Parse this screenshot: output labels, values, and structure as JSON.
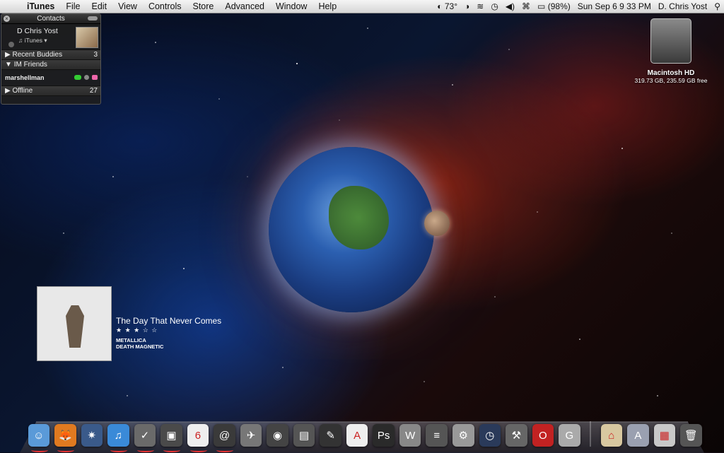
{
  "menubar": {
    "app_name": "iTunes",
    "menus": [
      "File",
      "Edit",
      "View",
      "Controls",
      "Store",
      "Advanced",
      "Window",
      "Help"
    ],
    "weather": "73°",
    "battery": "(98%)",
    "clock": "Sun Sep 6  9 33 PM",
    "user": "D. Chris Yost"
  },
  "contacts": {
    "title": "Contacts",
    "me_name": "D Chris Yost",
    "me_status": "iTunes",
    "groups": [
      {
        "label": "Recent Buddies",
        "count": "3"
      },
      {
        "label": "IM Friends",
        "count": ""
      },
      {
        "label": "Offline",
        "count": "27"
      }
    ],
    "buddy": "marshellman"
  },
  "drive": {
    "label": "Macintosh HD",
    "info": "319.73 GB, 235.59 GB free"
  },
  "nowplaying": {
    "track": "The Day That Never Comes",
    "rating": "★ ★ ★ ☆ ☆",
    "artist": "METALLICA",
    "album": "DEATH MAGNETIC"
  },
  "dock": {
    "items": [
      {
        "icon": "finder-icon",
        "color": "#5a9ad8",
        "glyph": "☺",
        "running": true
      },
      {
        "icon": "firefox-icon",
        "color": "#e07a20",
        "glyph": "🦊",
        "running": true
      },
      {
        "icon": "safari-icon",
        "color": "#3a5a8a",
        "glyph": "✷",
        "running": false
      },
      {
        "icon": "itunes-icon",
        "color": "#3a8ad8",
        "glyph": "♫",
        "running": true
      },
      {
        "icon": "check-icon",
        "color": "#6a6a6a",
        "glyph": "✓",
        "running": true
      },
      {
        "icon": "iphoto-icon",
        "color": "#4a4a4a",
        "glyph": "▣",
        "running": true
      },
      {
        "icon": "calendar-icon",
        "color": "#eeeeee",
        "glyph": "6",
        "running": true
      },
      {
        "icon": "address-book-icon",
        "color": "#3a3a3a",
        "glyph": "@",
        "running": true
      },
      {
        "icon": "airplane-icon",
        "color": "#777777",
        "glyph": "✈",
        "running": false
      },
      {
        "icon": "camera-icon",
        "color": "#444444",
        "glyph": "◉",
        "running": false
      },
      {
        "icon": "film-icon",
        "color": "#555555",
        "glyph": "▤",
        "running": false
      },
      {
        "icon": "tools-icon",
        "color": "#333333",
        "glyph": "✎",
        "running": false
      },
      {
        "icon": "acrobat-icon",
        "color": "#eeeeee",
        "glyph": "A",
        "running": false
      },
      {
        "icon": "photoshop-icon",
        "color": "#2a2a2a",
        "glyph": "Ps",
        "running": false
      },
      {
        "icon": "word-icon",
        "color": "#888888",
        "glyph": "W",
        "running": false
      },
      {
        "icon": "notes-icon",
        "color": "#555555",
        "glyph": "≡",
        "running": false
      },
      {
        "icon": "preferences-icon",
        "color": "#999999",
        "glyph": "⚙",
        "running": false
      },
      {
        "icon": "timemachine-icon",
        "color": "#2a3a5a",
        "glyph": "◷",
        "running": false
      },
      {
        "icon": "xcode-icon",
        "color": "#666666",
        "glyph": "⚒",
        "running": false
      },
      {
        "icon": "opera-icon",
        "color": "#c22222",
        "glyph": "O",
        "running": false
      },
      {
        "icon": "app-g-icon",
        "color": "#aaaaaa",
        "glyph": "G",
        "running": false
      },
      {
        "icon": "home-folder-icon",
        "color": "#d8c8a0",
        "glyph": "⌂",
        "running": false
      },
      {
        "icon": "applications-folder-icon",
        "color": "#9aa0b0",
        "glyph": "A",
        "running": false
      },
      {
        "icon": "downloads-stack-icon",
        "color": "#c8c8c8",
        "glyph": "▦",
        "running": false
      },
      {
        "icon": "trash-icon",
        "color": "#555555",
        "glyph": "🗑",
        "running": false
      }
    ]
  }
}
